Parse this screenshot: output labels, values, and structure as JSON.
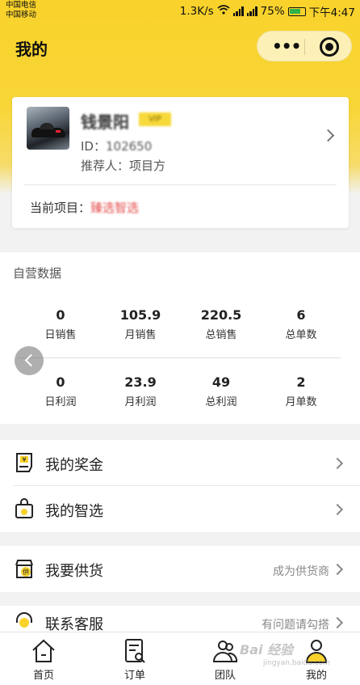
{
  "status_bar": {
    "carrier1": "中国电信",
    "carrier2": "中国移动",
    "speed": "1.3K/s",
    "battery": "75%",
    "time": "下午4:47"
  },
  "nav": {
    "title": "我的"
  },
  "profile": {
    "name": "钱景阳",
    "level": "VIP",
    "id_label": "ID：",
    "id_value": "102650",
    "referrer_label": "推荐人：",
    "referrer_value": "项目方",
    "project_label": "当前项目：",
    "project_value": "臻选智选"
  },
  "stats": {
    "title": "自营数据",
    "row1": [
      {
        "value": "0",
        "label": "日销售"
      },
      {
        "value": "105.9",
        "label": "月销售"
      },
      {
        "value": "220.5",
        "label": "总销售"
      },
      {
        "value": "6",
        "label": "总单数"
      }
    ],
    "row2": [
      {
        "value": "0",
        "label": "日利润"
      },
      {
        "value": "23.9",
        "label": "月利润"
      },
      {
        "value": "49",
        "label": "总利润"
      },
      {
        "value": "2",
        "label": "月单数"
      }
    ]
  },
  "menu": {
    "bonus": "我的奖金",
    "picks": "我的智选",
    "supply": "我要供货",
    "supply_hint": "成为供货商",
    "service": "联系客服",
    "service_hint": "有问题请勾搭"
  },
  "tabs": [
    {
      "label": "首页"
    },
    {
      "label": "订单"
    },
    {
      "label": "团队"
    },
    {
      "label": "我的"
    }
  ],
  "watermark": {
    "main": "Bai 经验",
    "sub": "jingyan.baidu.com"
  },
  "colors": {
    "brand_yellow": "#f9d22b",
    "accent_red": "#e54c4c",
    "badge_yellow": "#f7d93a"
  }
}
